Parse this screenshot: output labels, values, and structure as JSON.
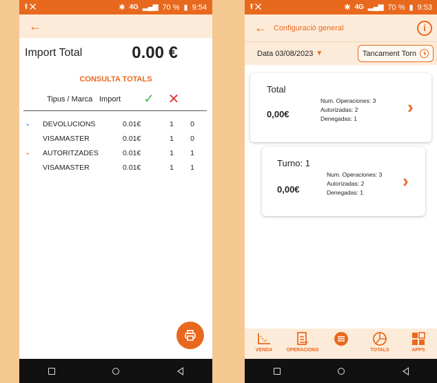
{
  "left": {
    "status": {
      "left_icons": "⭱ ✕",
      "right": "70 %",
      "time": "9:54",
      "network": "4G"
    },
    "import_total_label": "Import Total",
    "import_total_value": "0.00 €",
    "section_title": "CONSULTA TOTALS",
    "table": {
      "headers": {
        "marca": "Tipus / Marca",
        "import": "Import"
      },
      "rows": [
        {
          "expand": "v",
          "name": "DEVOLUCIONS",
          "import": "0.01€",
          "ok": "1",
          "ko": "0"
        },
        {
          "expand": "",
          "name": "VISAMASTER",
          "import": "0.01€",
          "ok": "1",
          "ko": "0"
        },
        {
          "expand": "v",
          "name": "AUTORITZADES",
          "import": "0.01€",
          "ok": "1",
          "ko": "1"
        },
        {
          "expand": "",
          "name": "VISAMASTER",
          "import": "0.01€",
          "ok": "1",
          "ko": "1"
        }
      ]
    }
  },
  "right": {
    "status": {
      "left_icons": "⭱ ✕",
      "right": "70 %",
      "time": "9:53",
      "network": "4G"
    },
    "title": "Configuració general",
    "date_label": "Data 03/08/2023",
    "close_button": "Tancament Torn",
    "cards": [
      {
        "title": "Total",
        "amount": "0,00€",
        "ops": "Num. Operaciones: 3",
        "auth": "Autorizadas: 2",
        "denied": "Denegadas: 1"
      },
      {
        "title": "Turno: 1",
        "amount": "0,00€",
        "ops": "Num. Operaciones: 3",
        "auth": "Autorizadas: 2",
        "denied": "Denegadas: 1"
      }
    ],
    "tabs": [
      {
        "label": "VENDA",
        "icon": "venda-icon"
      },
      {
        "label": "OPERACIONS",
        "icon": "operacions-icon"
      },
      {
        "label": "",
        "icon": "menu-icon"
      },
      {
        "label": "TOTALS",
        "icon": "totals-icon"
      },
      {
        "label": "APPS",
        "icon": "apps-icon"
      }
    ]
  },
  "colors": {
    "accent": "#e8691e",
    "bg": "#f5c891",
    "light": "#fdebd9"
  }
}
